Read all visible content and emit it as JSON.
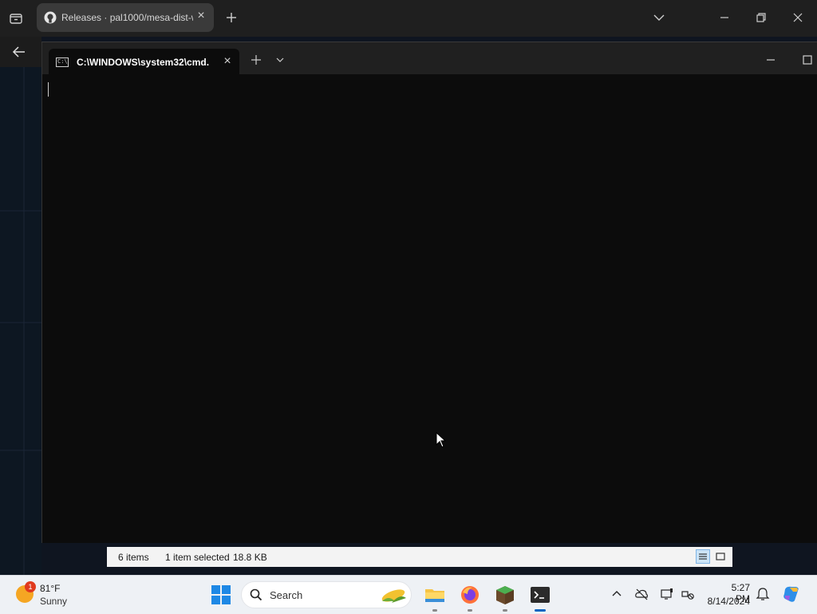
{
  "browser": {
    "tab_title": "Releases · pal1000/mesa-dist-w",
    "icons": {
      "tab_menu": "tab-actions-icon",
      "favicon": "github-icon",
      "close": "close-icon",
      "new_tab": "plus-icon",
      "back": "arrow-left-icon"
    }
  },
  "terminal": {
    "tab_title": "C:\\WINDOWS\\system32\\cmd.",
    "cmd_icon_text": "C:\\"
  },
  "explorer_status": {
    "item_count": "6 items",
    "selection": "1 item selected",
    "size": "18.8 KB"
  },
  "taskbar": {
    "weather": {
      "badge": "1",
      "temperature": "81°F",
      "condition": "Sunny"
    },
    "search_placeholder": "Search",
    "clock": {
      "time": "5:27 PM",
      "date": "8/14/2024"
    },
    "apps": [
      "file-explorer-icon",
      "firefox-icon",
      "minecraft-icon",
      "terminal-icon"
    ]
  },
  "colors": {
    "terminal_bg": "#0c0c0c",
    "titlebar_bg": "#202020",
    "taskbar_bg": "#eef1f5",
    "accent": "#0a66c2"
  }
}
